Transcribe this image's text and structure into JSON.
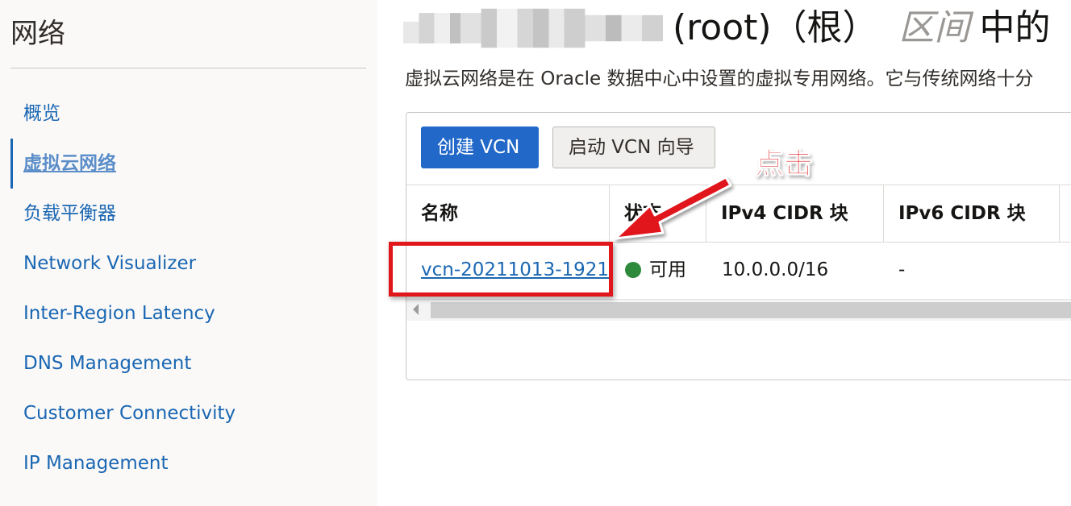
{
  "sidebar": {
    "title": "网络",
    "items": [
      {
        "label": "概览",
        "active": false
      },
      {
        "label": "虚拟云网络",
        "active": true
      },
      {
        "label": "负载平衡器",
        "active": false
      },
      {
        "label": "Network Visualizer",
        "active": false
      },
      {
        "label": "Inter-Region Latency",
        "active": false
      },
      {
        "label": "DNS Management",
        "active": false
      },
      {
        "label": "Customer Connectivity",
        "active": false
      },
      {
        "label": "IP Management",
        "active": false
      }
    ]
  },
  "header": {
    "root_label": "(root)（根）",
    "compartment_label": "区间",
    "suffix": "中的",
    "description": "虚拟云网络是在 Oracle 数据中心中设置的虚拟专用网络。它与传统网络十分"
  },
  "toolbar": {
    "create_label": "创建 VCN",
    "wizard_label": "启动 VCN 向导"
  },
  "table": {
    "columns": [
      "名称",
      "状态",
      "IPv4 CIDR 块",
      "IPv6 CIDR 块"
    ],
    "rows": [
      {
        "name": "vcn-20211013-1921",
        "status": "可用",
        "ipv4": "10.0.0.0/16",
        "ipv6": "-"
      }
    ]
  },
  "annotation": {
    "label": "点击",
    "color": "#e0161b"
  },
  "colors": {
    "link": "#1a67b3",
    "primary_button": "#2168c8",
    "status_available": "#2d8a3c"
  }
}
